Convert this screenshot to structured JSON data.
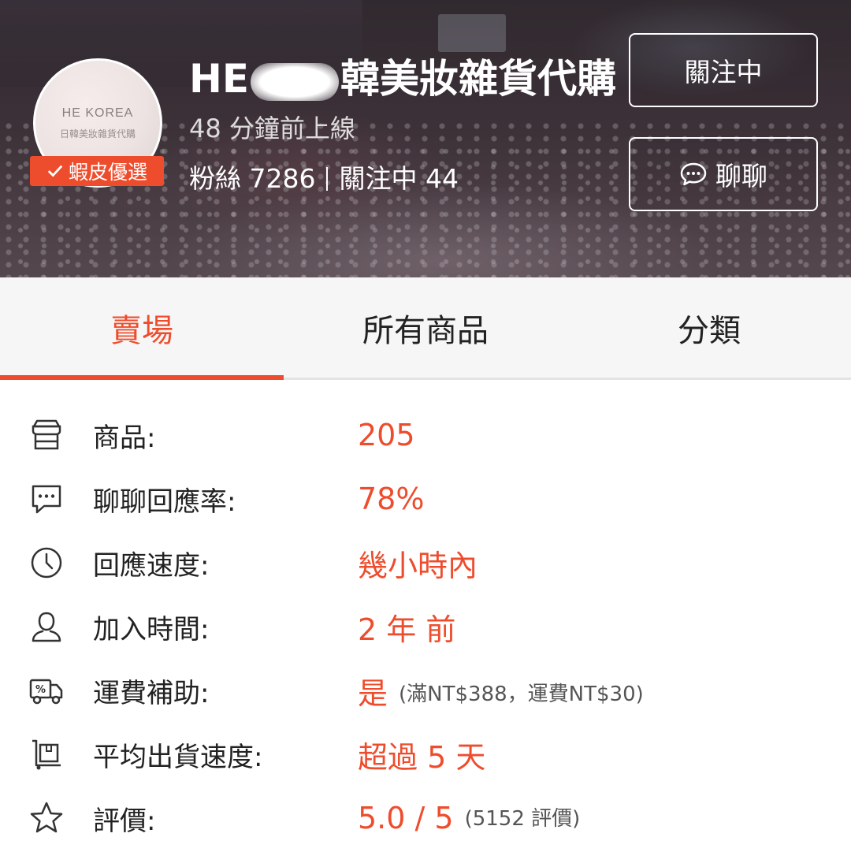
{
  "header": {
    "avatar_line1": "HE KOREA",
    "avatar_line2": "日韓美妝雜貨代購",
    "badge_label": "蝦皮優選",
    "shop_name_prefix": "HE",
    "shop_name_suffix": "韓美妝雜貨代購",
    "online_status": "48 分鐘前上線",
    "followers": "粉絲 7286",
    "following": "關注中 44",
    "follow_button": "關注中",
    "chat_button": "聊聊"
  },
  "tabs": [
    {
      "label": "賣場",
      "active": true
    },
    {
      "label": "所有商品",
      "active": false
    },
    {
      "label": "分類",
      "active": false
    }
  ],
  "info": {
    "products": {
      "label": "商品:",
      "value": "205",
      "icon": "store-icon"
    },
    "chat_rate": {
      "label": "聊聊回應率:",
      "value": "78%",
      "icon": "chat-bubble-icon"
    },
    "response_speed": {
      "label": "回應速度:",
      "value": "幾小時內",
      "icon": "clock-icon"
    },
    "joined": {
      "label": "加入時間:",
      "value": "2 年 前",
      "icon": "user-icon"
    },
    "shipping": {
      "label": "運費補助:",
      "value": "是",
      "note": "(滿NT$388，運費NT$30)",
      "icon": "delivery-truck-icon"
    },
    "ship_speed": {
      "label": "平均出貨速度:",
      "value": "超過 5 天",
      "icon": "package-trolley-icon"
    },
    "rating": {
      "label": "評價:",
      "value": "5.0 / 5",
      "note": "(5152 評價)",
      "icon": "star-icon"
    }
  },
  "colors": {
    "accent": "#ee4d2d",
    "text": "#222222",
    "tab_bg": "#f6f6f6"
  }
}
